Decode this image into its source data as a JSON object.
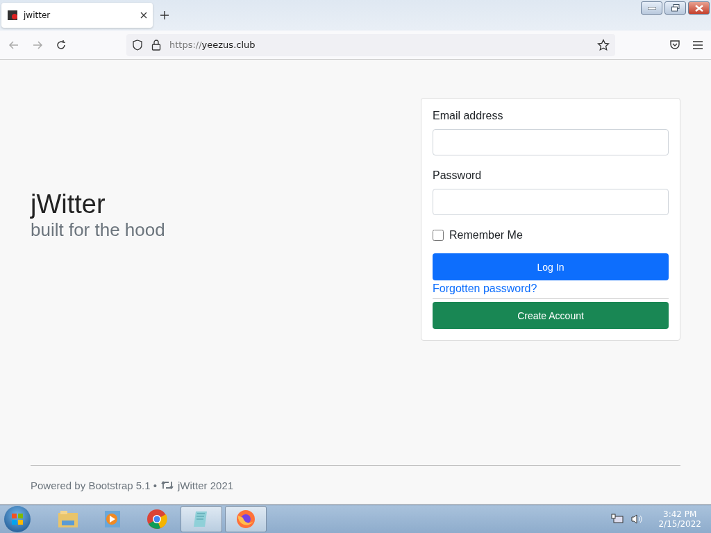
{
  "browser": {
    "tab": {
      "title": "jwitter",
      "selected": true
    },
    "url": {
      "scheme": "https://",
      "host": "yeezus.club"
    }
  },
  "hero": {
    "title": "jWitter",
    "subtitle": "built for the hood"
  },
  "login": {
    "email": {
      "label": "Email address"
    },
    "password": {
      "label": "Password"
    },
    "remember": {
      "label": "Remember Me",
      "checked": false
    },
    "login_button": "Log In",
    "forgot_link": "Forgotten password?",
    "create_button": "Create Account"
  },
  "footer": {
    "powered": "Powered by Bootstrap 5.1 •",
    "brand": "jWitter 2021"
  },
  "taskbar": {
    "apps": [
      {
        "kind": "explorer",
        "open": false
      },
      {
        "kind": "media",
        "open": false
      },
      {
        "kind": "chrome",
        "open": false
      },
      {
        "kind": "notepad",
        "open": true
      },
      {
        "kind": "firefox",
        "open": true
      }
    ],
    "time": "3:42 PM",
    "date": "2/15/2022"
  }
}
